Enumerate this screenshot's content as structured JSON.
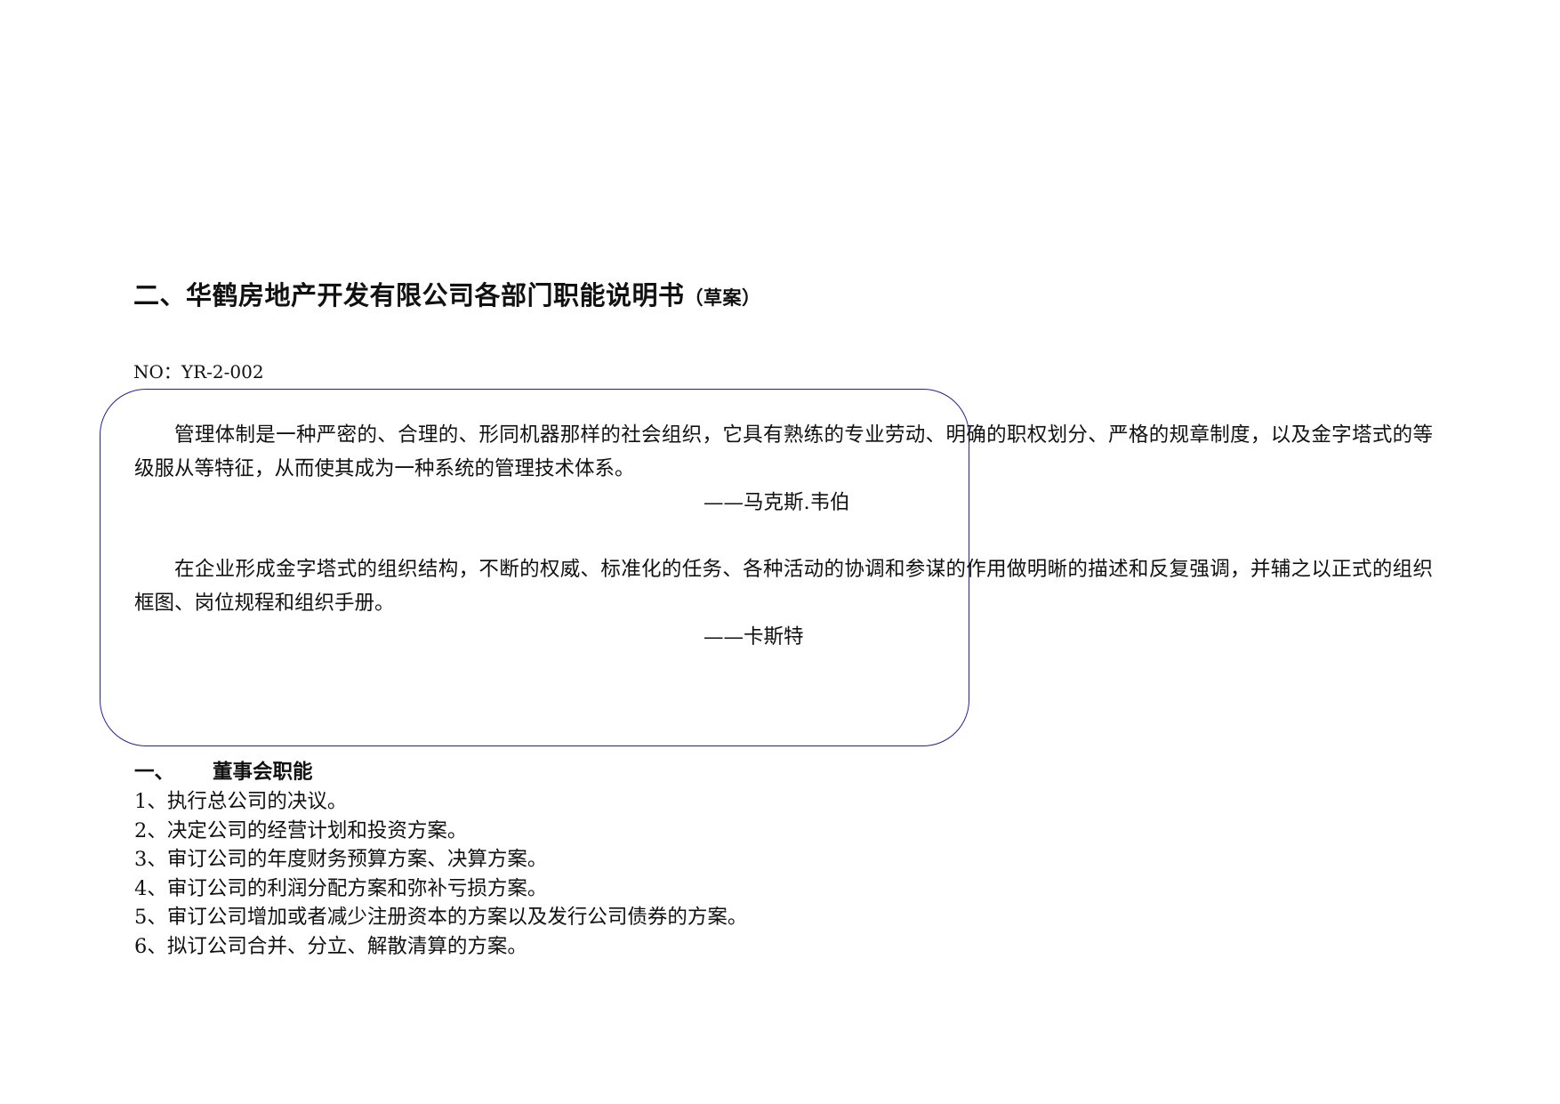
{
  "document": {
    "title_main": "二、华鹤房地产开发有限公司各部门职能说明书",
    "title_sub": "（草案）",
    "doc_number": "NO：YR-2-002"
  },
  "quotes": [
    {
      "text": "管理体制是一种严密的、合理的、形同机器那样的社会组织，它具有熟练的专业劳动、明确的职权划分、严格的规章制度，以及金字塔式的等级服从等特征，从而使其成为一种系统的管理技术体系。",
      "attribution": "——马克斯.韦伯"
    },
    {
      "text": "在企业形成金字塔式的组织结构，不断的权威、标准化的任务、各种活动的协调和参谋的作用做明晰的描述和反复强调，并辅之以正式的组织框图、岗位规程和组织手册。",
      "attribution": "——卡斯特"
    }
  ],
  "section": {
    "number": "一、",
    "title": "董事会职能",
    "items": [
      "1、执行总公司的决议。",
      "2、决定公司的经营计划和投资方案。",
      "3、审订公司的年度财务预算方案、决算方案。",
      "4、审订公司的利润分配方案和弥补亏损方案。",
      "5、审订公司增加或者减少注册资本的方案以及发行公司债券的方案。",
      "6、拟订公司合并、分立、解散清算的方案。"
    ]
  }
}
